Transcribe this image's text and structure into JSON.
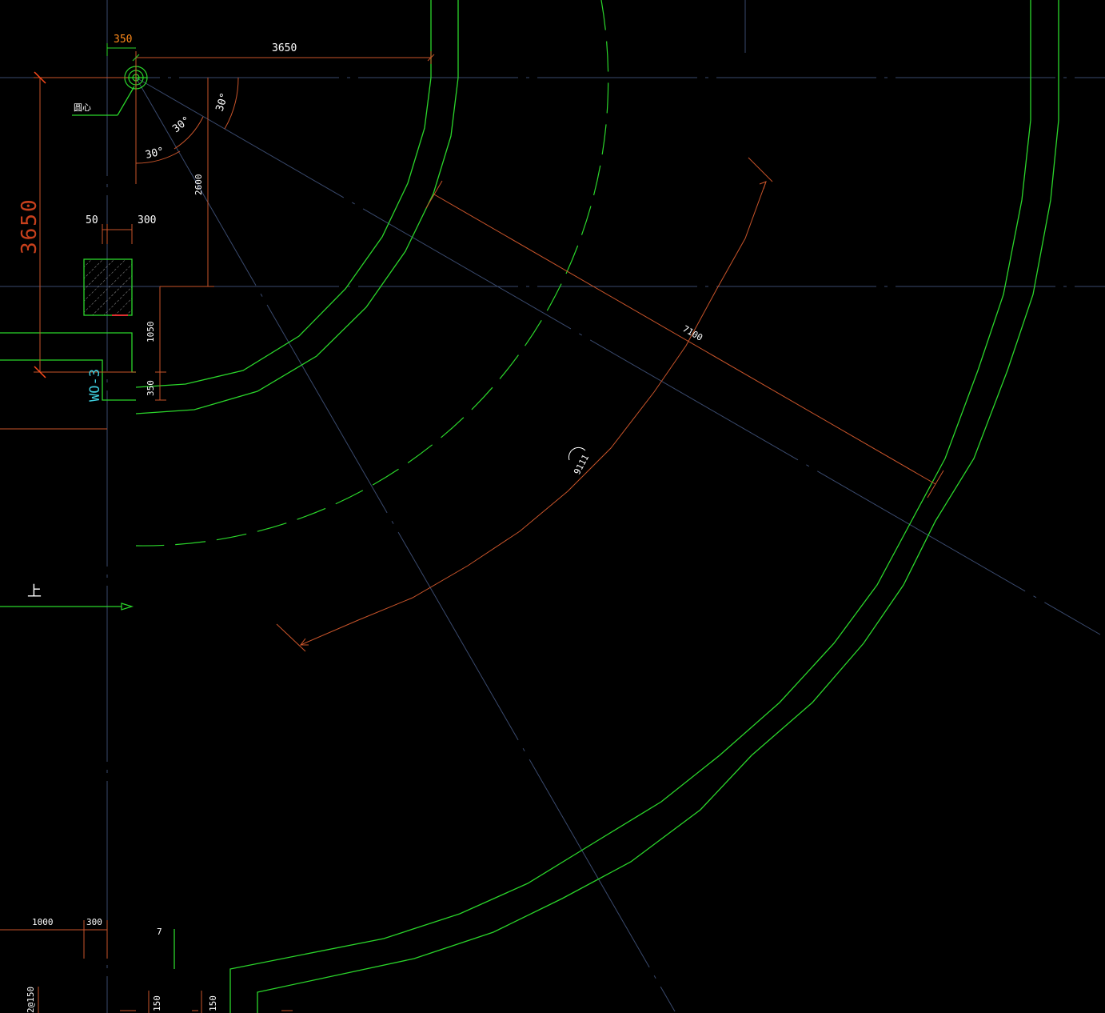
{
  "drawing": {
    "dims": {
      "top_offset": "350",
      "top_length": "3650",
      "left_height": "3650",
      "angle_top": "30°",
      "angle_mid": "30°",
      "angle_low": "30°",
      "inner_vertical": "2600",
      "col_gap": "50",
      "col_width": "300",
      "wall_drop": "1050",
      "wall_thick": "350",
      "chord_length": "7100",
      "arc_length": "9111",
      "bottom_a": "1000",
      "bottom_b": "300",
      "bottom_c": "7",
      "bottom_d": "2@150",
      "bottom_e": "150",
      "bottom_f": "150"
    },
    "labels": {
      "center_mark": "圆心",
      "wall_tag": "WO-3",
      "stair_up": "上"
    },
    "colors": {
      "background": "#000000",
      "wall_line": "#2bd62b",
      "dimension": "#c8542a",
      "axis": "#3a4a6e",
      "text": "#ffffff",
      "tag": "#3fd0e0",
      "highlight": "#ff8a1a"
    }
  }
}
